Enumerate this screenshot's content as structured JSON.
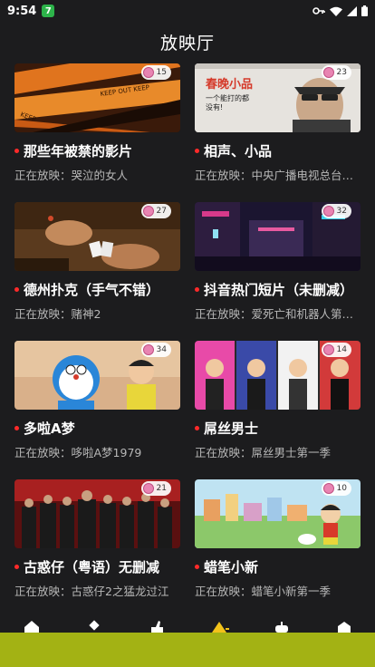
{
  "status_bar": {
    "time": "9:54",
    "app_badge": "7"
  },
  "page_title": "放映厅",
  "channels": [
    {
      "title": "那些年被禁的影片",
      "playing": "正在放映：哭泣的女人",
      "count": "15",
      "thumb": "caution-tape"
    },
    {
      "title": "相声、小品",
      "playing": "正在放映：中央广播电视总台…",
      "count": "23",
      "thumb": "skit",
      "thumb_text": "春晚小品",
      "thumb_caption": "一个能打的都没有!"
    },
    {
      "title": "德州扑克（手气不错）",
      "playing": "正在放映：赌神2",
      "count": "27",
      "thumb": "poker"
    },
    {
      "title": "抖音热门短片（未删减）",
      "playing": "正在放映：爱死亡和机器人第…",
      "count": "32",
      "thumb": "neon-street"
    },
    {
      "title": "多啦A梦",
      "playing": "正在放映：哆啦A梦1979",
      "count": "34",
      "thumb": "doraemon"
    },
    {
      "title": "屌丝男士",
      "playing": "正在放映：屌丝男士第一季",
      "count": "14",
      "thumb": "posters"
    },
    {
      "title": "古惑仔（粤语）无删减",
      "playing": "正在放映：古惑仔2之猛龙过江",
      "count": "21",
      "thumb": "gang"
    },
    {
      "title": "蜡笔小新",
      "playing": "正在放映：蜡笔小新第一季",
      "count": "10",
      "thumb": "shinchan"
    }
  ],
  "bottom_nav": [
    "home-icon",
    "grid-icon",
    "thumb-up-icon",
    "cinema-icon",
    "robot-icon",
    "profile-icon"
  ],
  "colors": {
    "background": "#1c1c1e",
    "dot": "#ff2a2a",
    "bottom_bar": "#a3b214",
    "subtitle": "#b7b7b7"
  }
}
